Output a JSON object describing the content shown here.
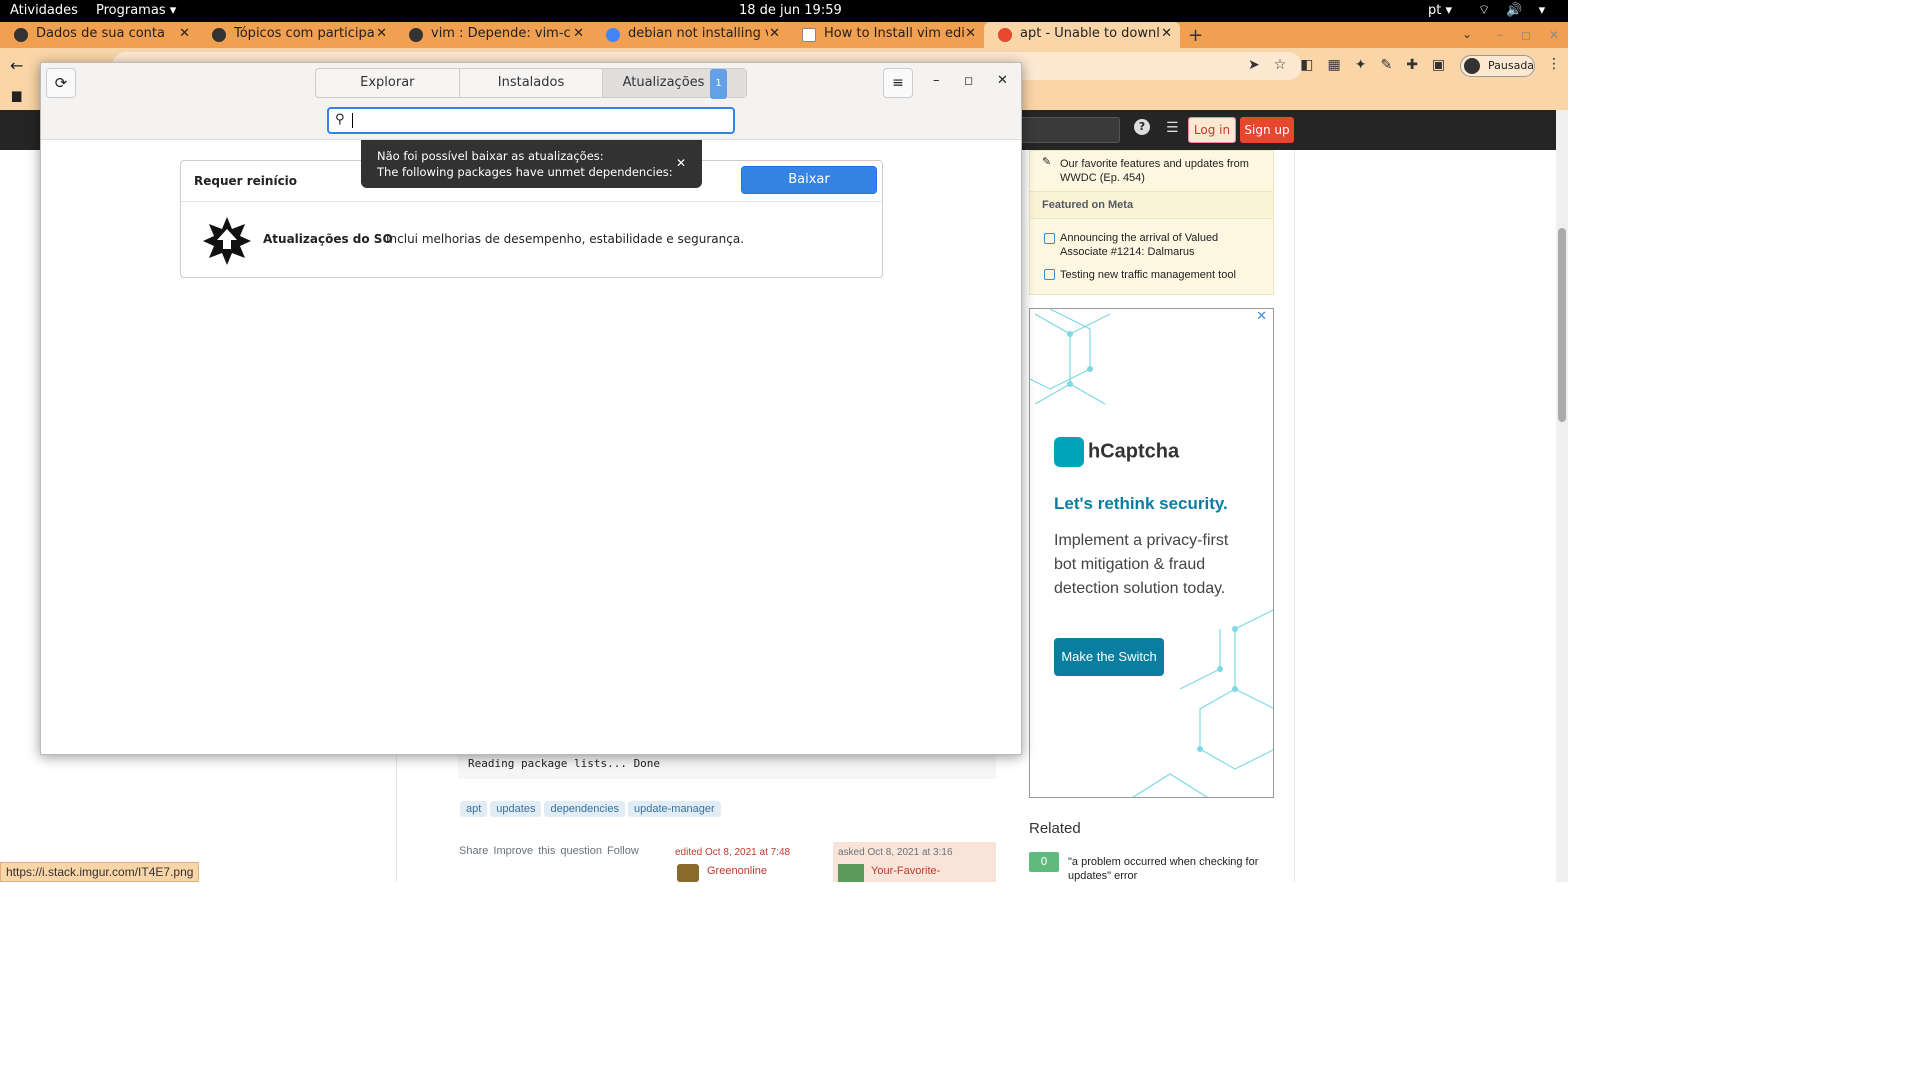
{
  "topbar": {
    "activities": "Atividades",
    "programs": "Programas ▾",
    "clock": "18 de jun  19:59",
    "lang": "pt ▾",
    "sys_icons": "⌔ 🔊 ▾"
  },
  "tabs": [
    {
      "title": "Dados de sua conta"
    },
    {
      "title": "Tópicos com participação"
    },
    {
      "title": "vim : Depende: vim-comm"
    },
    {
      "title": "debian not installing vim"
    },
    {
      "title": "How to Install vim editor o"
    },
    {
      "title": "apt - Unable to download"
    }
  ],
  "browser": {
    "profile": "Pausada",
    "status_url": "https://i.stack.imgur.com/IT4E7.png"
  },
  "so": {
    "login": "Log in",
    "signup": "Sign up",
    "blog_item": "Our favorite features and updates from WWDC (Ep. 454)",
    "featured_meta": "Featured on Meta",
    "meta_items": [
      "Announcing the arrival of Valued Associate #1214: Dalmarus",
      "Testing new traffic management tool"
    ],
    "code_line": "Reading package lists... Done",
    "tags": [
      "apt",
      "updates",
      "dependencies",
      "update-manager"
    ],
    "post_menu": "Share  Improve this question  Follow",
    "edited": "edited Oct 8, 2021 at 7:48",
    "editor": "Greenonline",
    "asked": "asked Oct 8, 2021 at 3:16",
    "asker": "Your-Favorite-",
    "related_title": "Related",
    "related_score": "0",
    "related_text": "\"a problem occurred when checking for updates\" error"
  },
  "ad": {
    "brand": "hCaptcha",
    "headline": "Let's rethink security.",
    "body": "Implement a privacy-first bot mitigation & fraud detection solution today.",
    "cta": "Make the Switch"
  },
  "software": {
    "tabs": {
      "explore": "Explorar",
      "installed": "Instalados",
      "updates": "Atualizações",
      "updates_count": "1"
    },
    "toast_line1": "Não foi possível baixar as atualizações:",
    "toast_line2": "The following packages have unmet dependencies:",
    "card_header": "Requer reinício",
    "download_button": "Baixar",
    "os_name": "Atualizações do SO",
    "os_desc": "Inclui melhorias de desempenho, estabilidade e segurança."
  },
  "colors": {
    "accent": "#3584e4",
    "browser_chrome": "#f9d5a8",
    "so_orange": "#e8472d"
  }
}
